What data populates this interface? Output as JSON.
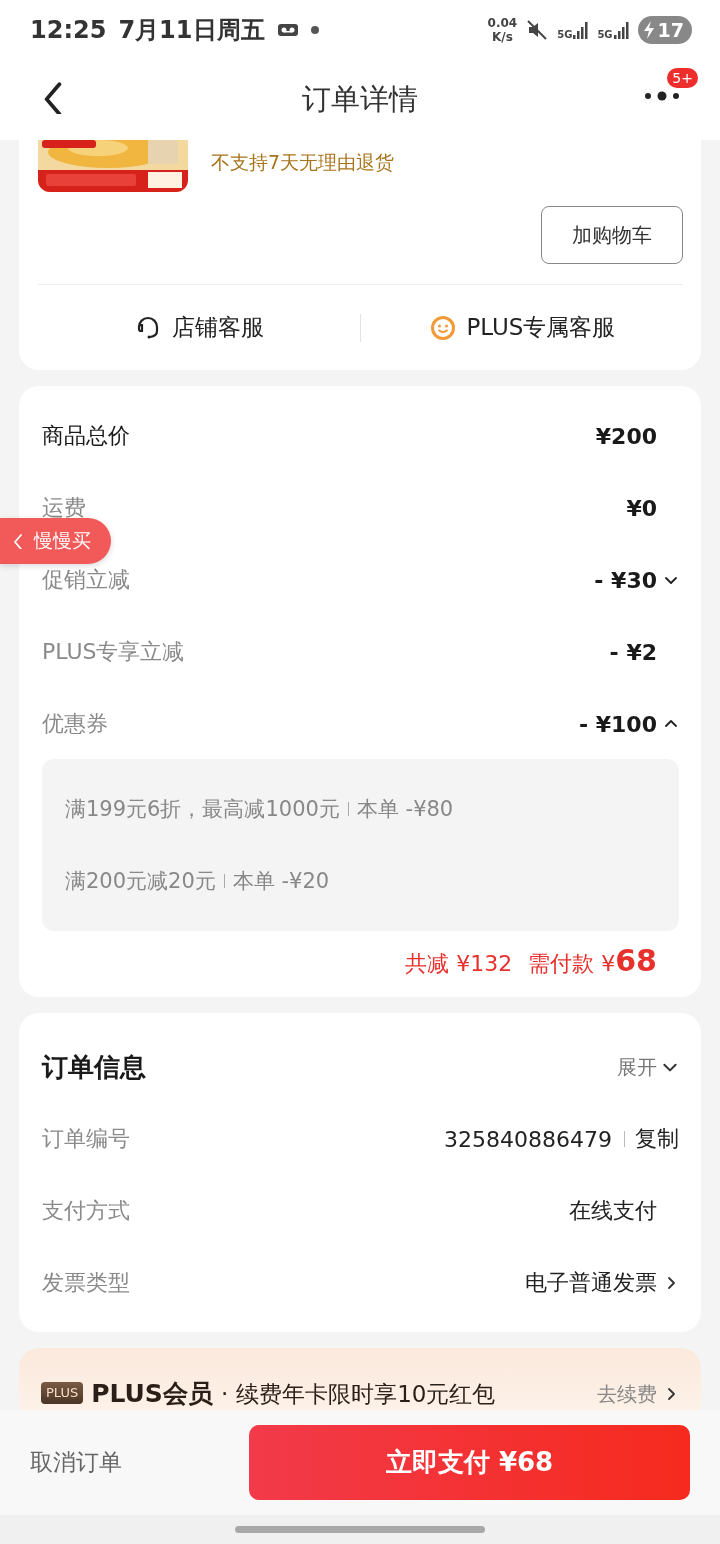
{
  "status_bar": {
    "time": "12:25",
    "date": "7月11日周五",
    "net_speed_value": "0.04",
    "net_speed_unit": "K/s",
    "signals": [
      {
        "label": "5G"
      },
      {
        "label": "5G"
      }
    ],
    "battery": "17"
  },
  "header": {
    "title": "订单详情",
    "badge": "5+"
  },
  "product": {
    "notice": "不支持7天无理由退货",
    "add_to_cart": "加购物车"
  },
  "services": [
    {
      "kind": "headset",
      "label": "店铺客服"
    },
    {
      "kind": "smiley",
      "label": "PLUS专属客服"
    }
  ],
  "price_rows": [
    {
      "kind": "total",
      "label": "商品总价",
      "value": "¥200"
    },
    {
      "kind": "plain",
      "label": "运费",
      "value": "¥0"
    },
    {
      "kind": "expandable",
      "label": "促销立减",
      "value": "- ¥30",
      "expanded": false
    },
    {
      "kind": "plain",
      "label": "PLUS专享立减",
      "value": "- ¥2"
    },
    {
      "kind": "expandable",
      "label": "优惠券",
      "value": "- ¥100",
      "expanded": true,
      "details": [
        {
          "text": "满199元6折，最高减1000元",
          "amount": "本单 -¥80"
        },
        {
          "text": "满200元减20元",
          "amount": "本单 -¥20"
        }
      ]
    }
  ],
  "summary": {
    "saved": "共减 ¥132",
    "due_label": "需付款 ¥",
    "due_amount": "68"
  },
  "order_info": {
    "title": "订单信息",
    "toggle": "展开",
    "expanded": false,
    "rows": [
      {
        "label": "订单编号",
        "value": "325840886479",
        "action": "复制"
      },
      {
        "label": "支付方式",
        "value": "在线支付",
        "link": false
      },
      {
        "label": "发票类型",
        "value": "电子普通发票",
        "link": true
      }
    ]
  },
  "plus_banner": {
    "badge": "PLUS",
    "title": "PLUS会员",
    "separator": "·",
    "text": "续费年卡限时享10元红包",
    "action": "去续费"
  },
  "floating_tab": {
    "label": "慢慢买"
  },
  "bottom_bar": {
    "cancel": "取消订单",
    "pay": "立即支付 ¥68"
  }
}
